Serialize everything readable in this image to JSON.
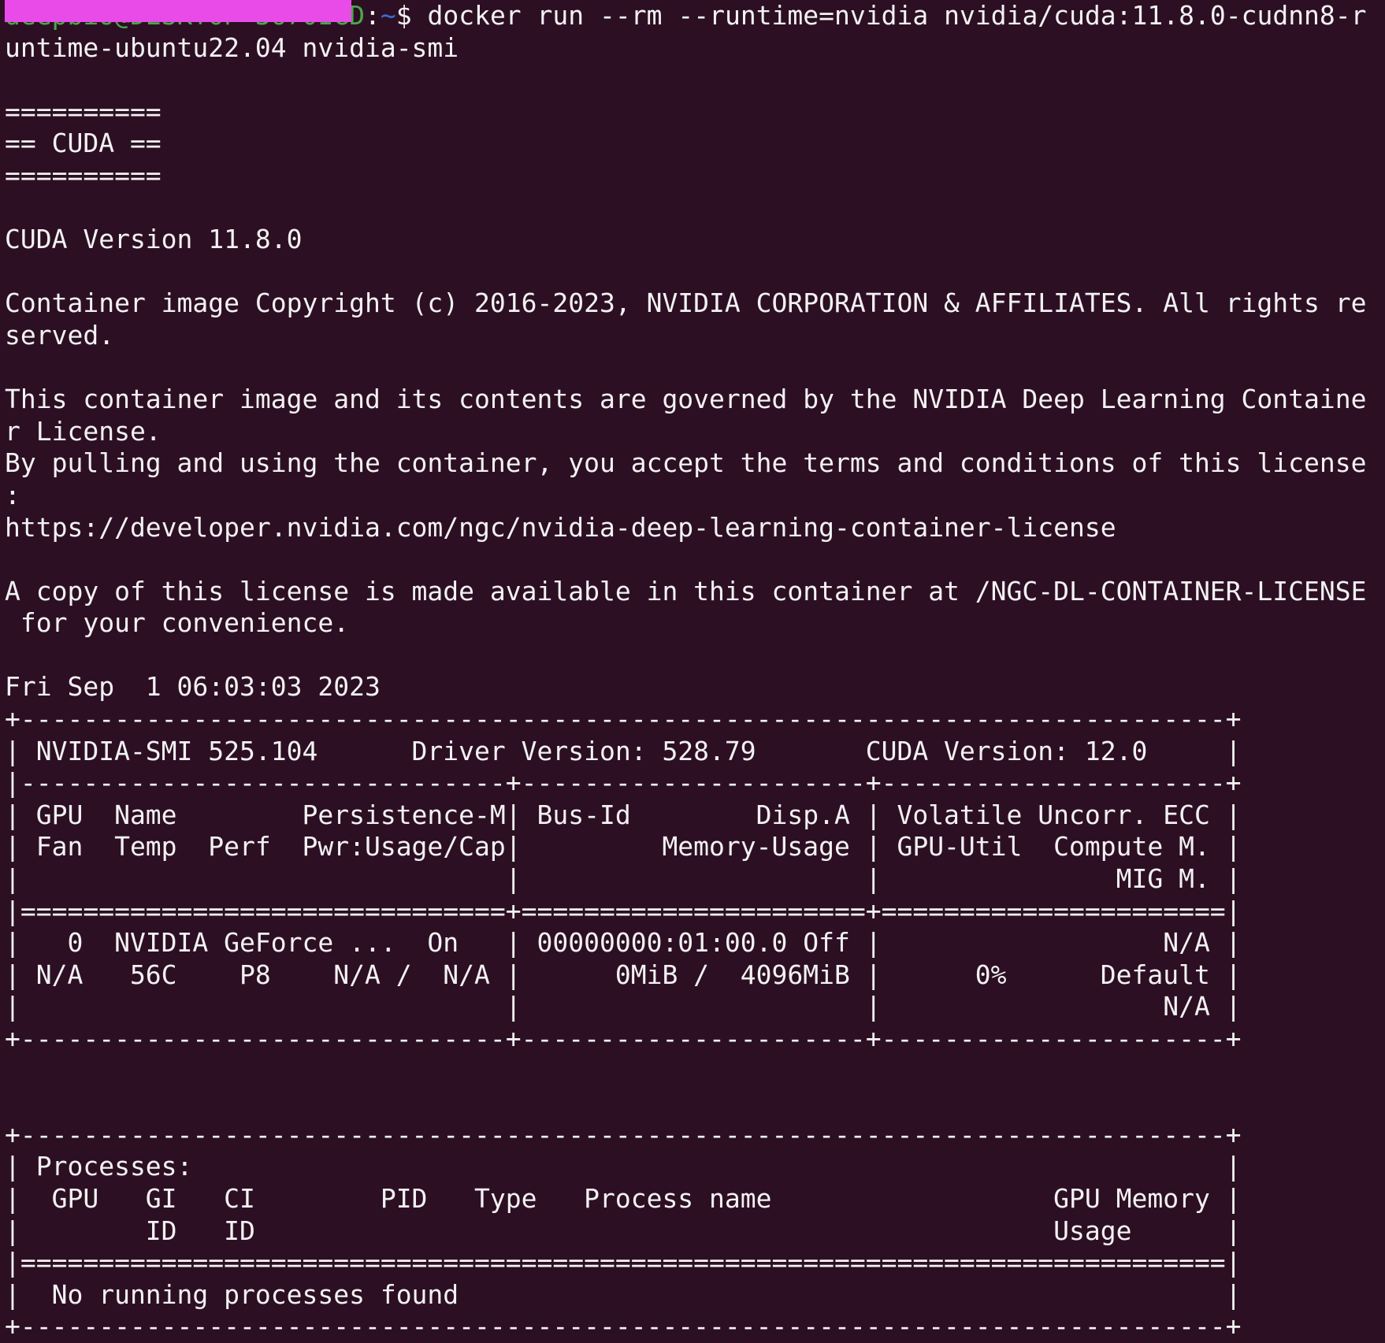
{
  "prompt": {
    "user_host": "deepbio@DESKTOP-3670IGD",
    "separator": ":",
    "path": "~",
    "symbol": "$ ",
    "command": "docker run --rm --runtime=nvidia nvidia/cuda:11.8.0-cudnn8-r",
    "command_wrap": "untime-ubuntu22.04 nvidia-smi"
  },
  "output": [
    "",
    "==========",
    "== CUDA ==",
    "==========",
    "",
    "CUDA Version 11.8.0",
    "",
    "Container image Copyright (c) 2016-2023, NVIDIA CORPORATION & AFFILIATES. All rights re",
    "served.",
    "",
    "This container image and its contents are governed by the NVIDIA Deep Learning Containe",
    "r License.",
    "By pulling and using the container, you accept the terms and conditions of this license",
    ":",
    "https://developer.nvidia.com/ngc/nvidia-deep-learning-container-license",
    "",
    "A copy of this license is made available in this container at /NGC-DL-CONTAINER-LICENSE",
    " for your convenience.",
    "",
    "Fri Sep  1 06:03:03 2023",
    "+-----------------------------------------------------------------------------+",
    "| NVIDIA-SMI 525.104      Driver Version: 528.79       CUDA Version: 12.0     |",
    "|-------------------------------+----------------------+----------------------+",
    "| GPU  Name        Persistence-M| Bus-Id        Disp.A | Volatile Uncorr. ECC |",
    "| Fan  Temp  Perf  Pwr:Usage/Cap|         Memory-Usage | GPU-Util  Compute M. |",
    "|                               |                      |               MIG M. |",
    "|===============================+======================+======================|",
    "|   0  NVIDIA GeForce ...  On   | 00000000:01:00.0 Off |                  N/A |",
    "| N/A   56C    P8    N/A /  N/A |      0MiB /  4096MiB |      0%      Default |",
    "|                               |                      |                  N/A |",
    "+-------------------------------+----------------------+----------------------+",
    "",
    "",
    "+-----------------------------------------------------------------------------+",
    "| Processes:                                                                  |",
    "|  GPU   GI   CI        PID   Type   Process name                  GPU Memory |",
    "|        ID   ID                                                   Usage      |",
    "|=============================================================================|",
    "|  No running processes found                                                 |",
    "+-----------------------------------------------------------------------------+"
  ]
}
